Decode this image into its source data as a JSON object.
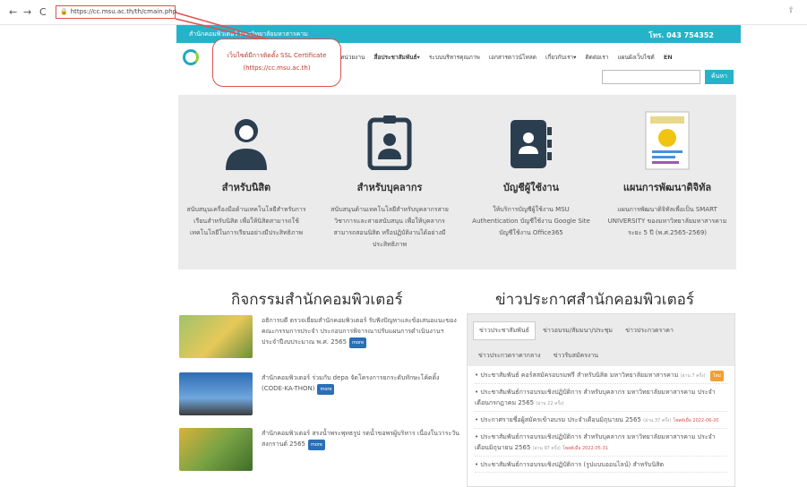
{
  "browser": {
    "url": "https://cc.msu.ac.th/th/cmain.php",
    "back": "←",
    "forward": "→",
    "reload": "C",
    "share": "⇪"
  },
  "topbar": {
    "dept": "สำนักคอมพิวเตอร์ มหาวิทยาลัยมหาสารคาม",
    "phone": "โทร. 043 754352"
  },
  "callout": {
    "line1": "เว็บไซต์มีการติดตั้ง SSL Certificate",
    "line2": "(https://cc.msu.ac.th)"
  },
  "menu": {
    "items": [
      "หน่วยงาน",
      "สื่อประชาสัมพันธ์▾",
      "ระบบบริหารคุณภาพ",
      "เอกสารดาวน์โหลด",
      "เกี่ยวกับเรา▾",
      "ติดต่อเรา",
      "แผนผังเว็บไซต์",
      "EN"
    ]
  },
  "search": {
    "button": "ค้นหา",
    "placeholder": ""
  },
  "cards": [
    {
      "title": "สำหรับนิสิต",
      "desc": "สนับสนุนเครื่องมือด้านเทคโนโลยีสำหรับการเรียนสำหรับนิสิต เพื่อให้นิสิตสามารถใช้เทคโนโลยีในการเรียนอย่างมีประสิทธิภาพ"
    },
    {
      "title": "สำหรับบุคลากร",
      "desc": "สนับสนุนด้านเทคโนโลยีสำหรับบุคลากรสายวิชาการและสายสนับสนุน เพื่อให้บุคลากรสามารถสอนนิสิต หรือปฏิบัติงานได้อย่างมีประสิทธิภาพ"
    },
    {
      "title": "บัญชีผู้ใช้งาน",
      "desc": "ให้บริการบัญชีผู้ใช้งาน MSU Authentication บัญชีใช้งาน Google Site บัญชีใช้งาน Office365"
    },
    {
      "title": "แผนการพัฒนาดิจิทัล",
      "desc": "แผนการพัฒนาดิจิทัลเพื่อเป็น SMART UNIVERSITY ของมหาวิทยาลัยมหาสารคาม ระยะ 5 ปี (พ.ศ.2565-2569)"
    }
  ],
  "activities": {
    "title": "กิจกรรมสำนักคอมพิวเตอร์",
    "more": "more",
    "items": [
      {
        "text": "อธิการบดี ตรวจเยี่ยมสำนักคอมพิวเตอร์ รับฟังปัญหาและข้อเสนอแนะของคณะกรรมการประจำ ประกอบการพิจารณาปรับแผนการดำเนินงานฯ ประจำปีงบประมาณ พ.ศ. 2565"
      },
      {
        "text": "สำนักคอมพิวเตอร์ ร่วมกับ depa จัดโครงการยกระดับทักษะโค้ดดิ้ง (CODE-KA-THON)"
      },
      {
        "text": "สำนักคอมพิวเตอร์ สรงน้ำพระพุทธรูป รดน้ำขอพรผู้บริหาร เนื่องในวาระวันสงกรานต์ 2565"
      }
    ]
  },
  "news": {
    "title": "ข่าวประกาศสำนักคอมพิวเตอร์",
    "tabs": [
      "ข่าวประชาสัมพันธ์",
      "ข่าวอบรม/สัมมนา/ประชุม",
      "ข่าวประกวดราคา",
      "ข่าวประกวดราคากลาง",
      "ข่าวรับสมัครงาน"
    ],
    "items": [
      {
        "text": "ประชาสัมพันธ์ คอร์สสมัครอบรมฟรี สำหรับนิสิต มหาวิทยาลัยมหาสารคาม",
        "meta": "(อ่าน 7 ครั้ง)",
        "tag": "ใหม่"
      },
      {
        "text": "ประชาสัมพันธ์การอบรมเชิงปฏิบัติการ สำหรับบุคลากร มหาวิทยาลัยมหาสารคาม ประจำเดือนกรกฎาคม 2565",
        "meta": "(อ่าน 22 ครั้ง)",
        "tag": ""
      },
      {
        "text": "ประกาศรายชื่อผู้สมัครเข้าอบรม ประจำเดือนมิถุนายน 2565",
        "meta": "(อ่าน 37 ครั้ง)",
        "tag": "โพสต์เมื่อ 2022-06-20"
      },
      {
        "text": "ประชาสัมพันธ์การอบรมเชิงปฏิบัติการ สำหรับบุคลากร มหาวิทยาลัยมหาสารคาม ประจำเดือนมิถุนายน 2565",
        "meta": "(อ่าน 97 ครั้ง)",
        "tag": "โพสต์เมื่อ 2022-05-31"
      },
      {
        "text": "ประชาสัมพันธ์การอบรมเชิงปฏิบัติการ (รูปแบบออนไลน์) สำหรับนิสิต",
        "meta": "",
        "tag": ""
      }
    ]
  },
  "colors": {
    "accent": "#26b3c9",
    "callout": "#d9534f",
    "band": "#ebebeb"
  }
}
